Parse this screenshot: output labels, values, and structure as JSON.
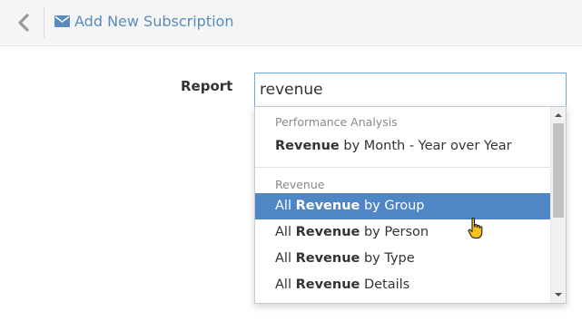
{
  "header": {
    "back_icon": "chevron-left-icon",
    "title_icon": "envelope-icon",
    "title": "Add New Subscription"
  },
  "form": {
    "report_label": "Report",
    "report_value": "revenue"
  },
  "dropdown": {
    "groups": [
      {
        "label": "Performance Analysis",
        "options": [
          {
            "prefix": "",
            "match": "Revenue",
            "suffix": " by Month - Year over Year",
            "highlighted": false
          }
        ]
      },
      {
        "label": "Revenue",
        "options": [
          {
            "prefix": "All ",
            "match": "Revenue",
            "suffix": " by Group",
            "highlighted": true
          },
          {
            "prefix": "All ",
            "match": "Revenue",
            "suffix": " by Person",
            "highlighted": false
          },
          {
            "prefix": "All ",
            "match": "Revenue",
            "suffix": " by Type",
            "highlighted": false
          },
          {
            "prefix": "All ",
            "match": "Revenue",
            "suffix": " Details",
            "highlighted": false
          }
        ]
      }
    ]
  },
  "colors": {
    "accent": "#4f86c6",
    "title_link": "#5a8bbf",
    "input_border": "#6ea7d8"
  },
  "cursor_icon": "hand-pointer-icon"
}
